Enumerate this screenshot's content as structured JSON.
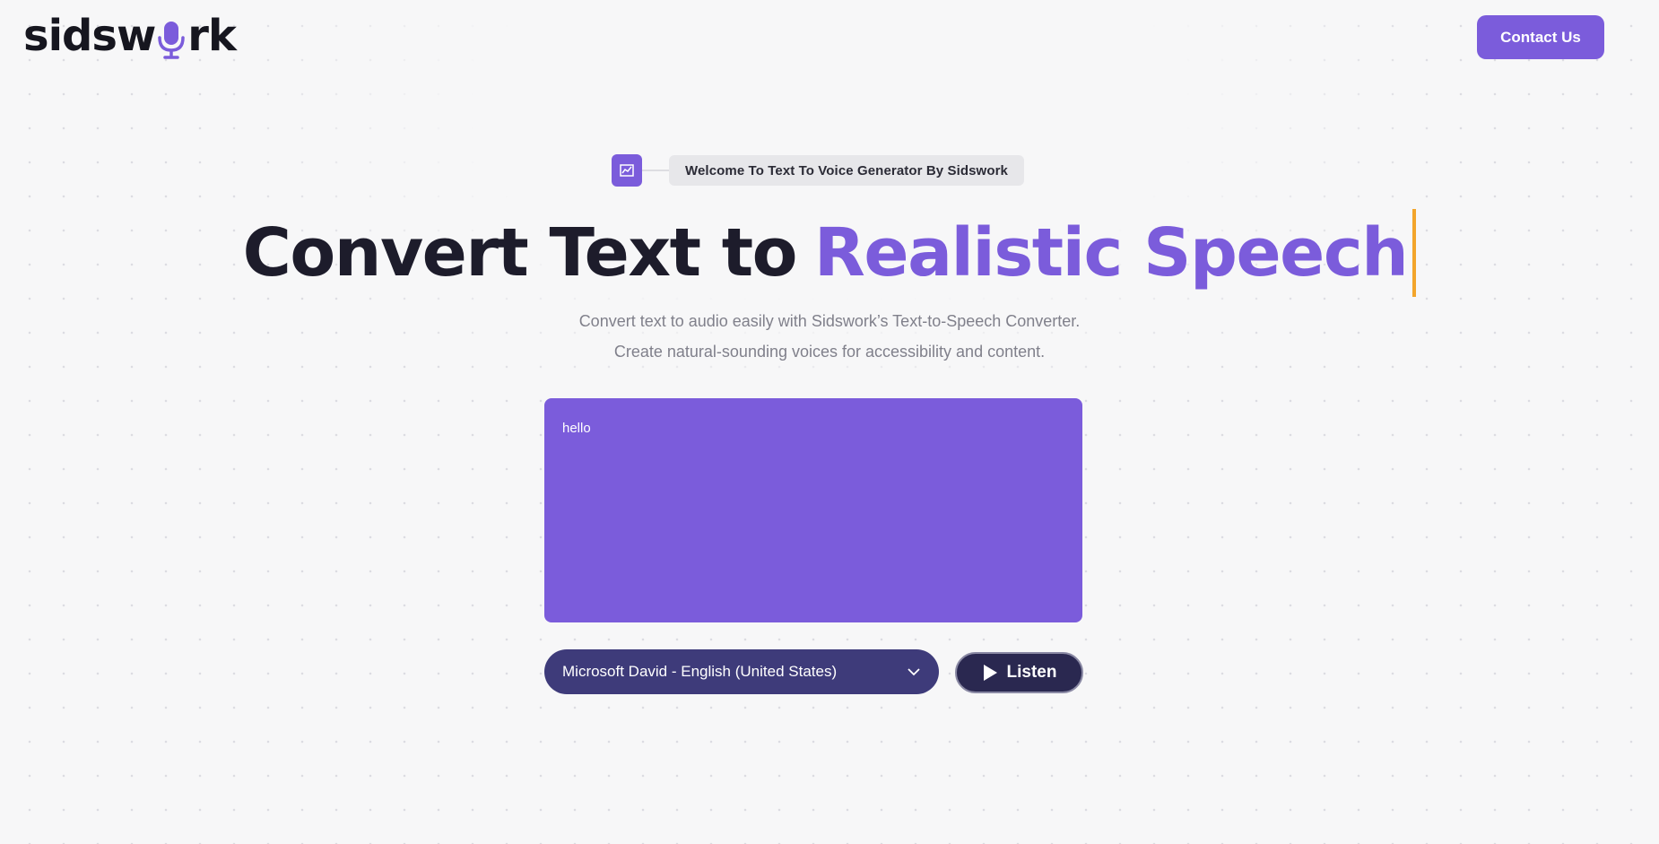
{
  "header": {
    "logo_before": "sidsw",
    "logo_after": "rk",
    "contact_label": "Contact Us"
  },
  "welcome": {
    "text": "Welcome To Text To Voice Generator By Sidswork"
  },
  "hero": {
    "title_dark": "Convert Text to",
    "title_accent": "Realistic Speech",
    "subtitle_line1": "Convert text to audio easily with Sidswork’s Text-to-Speech Converter.",
    "subtitle_line2": "Create natural-sounding voices for accessibility and content."
  },
  "converter": {
    "text_value": "hello",
    "voice_selected": "Microsoft David - English (United States)",
    "listen_label": "Listen"
  },
  "colors": {
    "accent": "#7b5cdb",
    "dark": "#1d1c2b",
    "caret": "#f3a52b",
    "select_bg": "#3e3b7a",
    "button_dark": "#2a2850"
  },
  "icons": {
    "logo_o": "microphone-icon",
    "badge": "chart-icon",
    "select_arrow": "chevron-down-icon",
    "listen": "play-icon"
  }
}
